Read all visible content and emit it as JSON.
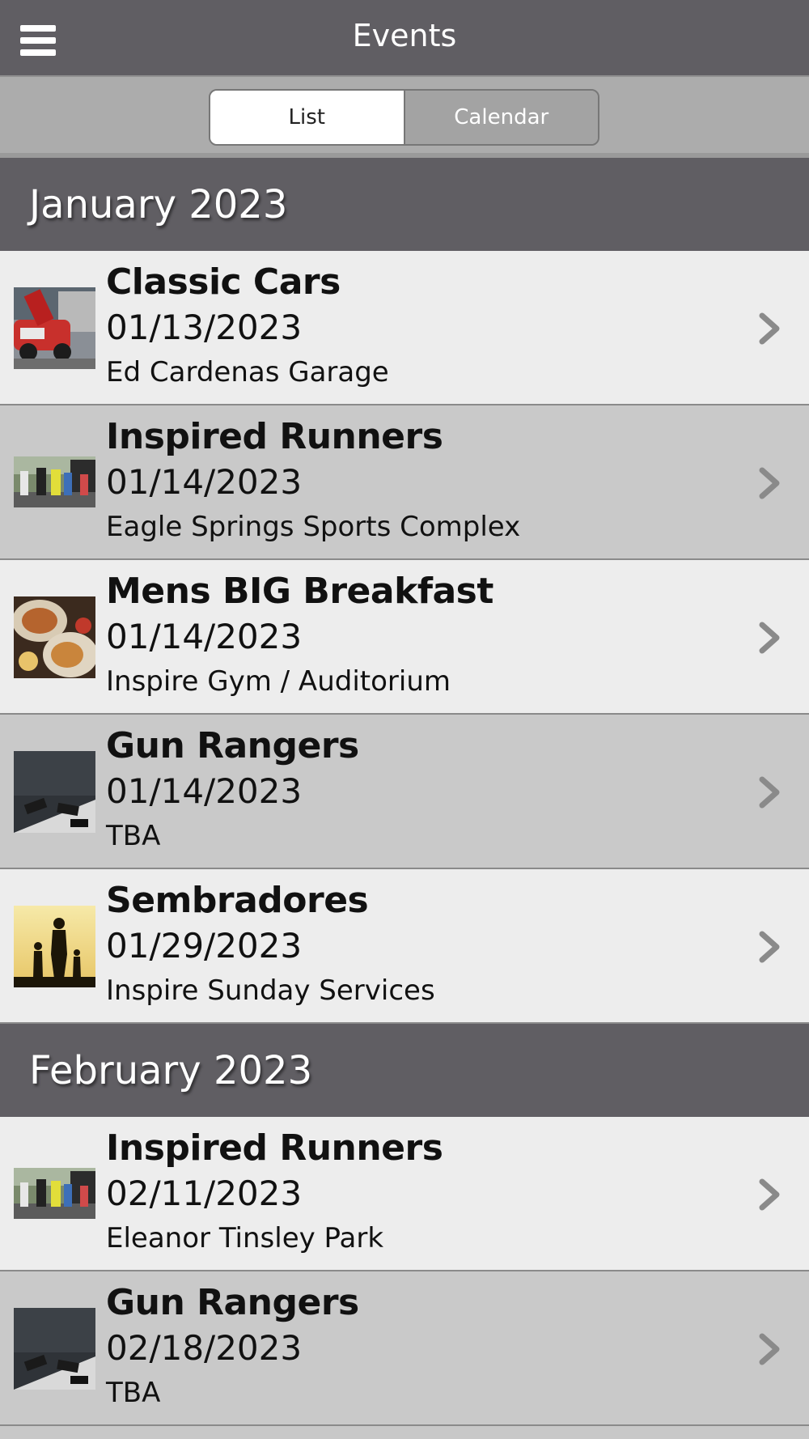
{
  "header": {
    "title": "Events",
    "menu_icon": "hamburger-menu-icon"
  },
  "tabs": {
    "list_label": "List",
    "calendar_label": "Calendar",
    "selected": "List"
  },
  "months": [
    {
      "label": "January 2023",
      "events": [
        {
          "name": "Classic Cars",
          "date": "01/13/2023",
          "location": "Ed Cardenas Garage",
          "thumbnail": "classic-cars-photo"
        },
        {
          "name": "Inspired Runners",
          "date": "01/14/2023",
          "location": "Eagle Springs Sports Complex",
          "thumbnail": "runners-photo"
        },
        {
          "name": "Mens BIG Breakfast",
          "date": "01/14/2023",
          "location": "Inspire Gym / Auditorium",
          "thumbnail": "breakfast-photo"
        },
        {
          "name": "Gun Rangers",
          "date": "01/14/2023",
          "location": "TBA",
          "thumbnail": "gun-range-photo"
        },
        {
          "name": "Sembradores",
          "date": "01/29/2023",
          "location": "Inspire Sunday Services",
          "thumbnail": "family-silhouette-photo"
        }
      ]
    },
    {
      "label": "February 2023",
      "events": [
        {
          "name": "Inspired Runners",
          "date": "02/11/2023",
          "location": "Eleanor Tinsley Park",
          "thumbnail": "runners-photo"
        },
        {
          "name": "Gun Rangers",
          "date": "02/18/2023",
          "location": "TBA",
          "thumbnail": "gun-range-photo"
        }
      ]
    }
  ],
  "colors": {
    "header_bg": "#605e63",
    "row_light": "#ededed",
    "row_dark": "#c9c9c9",
    "segment_bar": "#acacac",
    "chevron": "#8a8a8a"
  }
}
